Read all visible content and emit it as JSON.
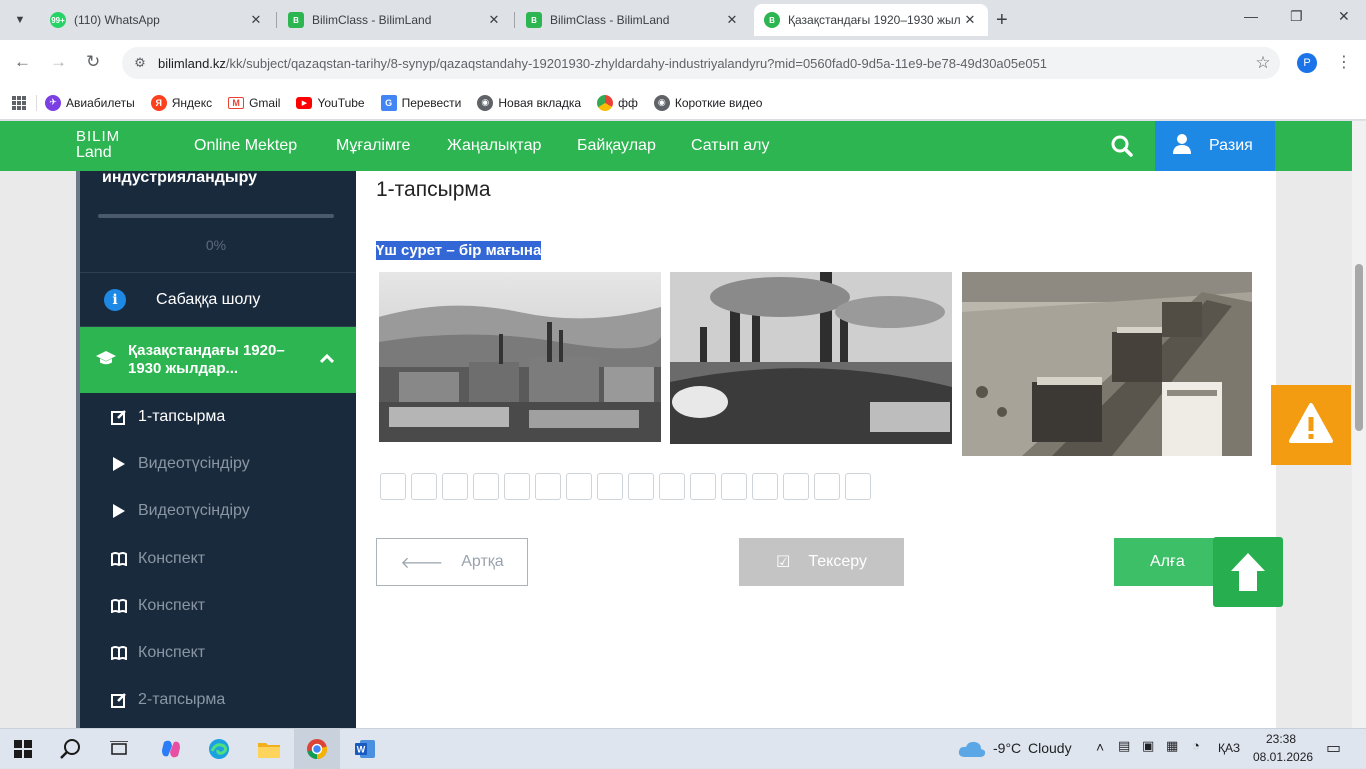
{
  "browser": {
    "tabs": [
      {
        "title": "(110) WhatsApp",
        "badge": "99+",
        "icon": "whatsapp-icon",
        "color": "#25d366"
      },
      {
        "title": "BilimClass - BilimLand",
        "icon": "bilimclass-icon",
        "color": "#2cb551"
      },
      {
        "title": "BilimClass - BilimLand",
        "icon": "bilimclass-icon",
        "color": "#2cb551"
      },
      {
        "title": "Қазақстандағы 1920–1930 жыл",
        "icon": "bilimland-icon",
        "color": "#2cb551"
      }
    ],
    "url_host": "bilimland.kz",
    "url_path": "/kk/subject/qazaqstan-tarihy/8-synyp/qazaqstandahy-19201930-zhyldardahy-industriyalandyru?mid=0560fad0-9d5a-11e9-be78-49d30a05e051",
    "profile_initial": "P",
    "bookmarks": [
      {
        "label": "Авиабилеты",
        "icon": "aviasales-icon",
        "color": "#7b3fe4"
      },
      {
        "label": "Яндекс",
        "icon": "yandex-icon",
        "color": "#fc3f1d"
      },
      {
        "label": "Gmail",
        "icon": "gmail-icon",
        "color": "#ea4335"
      },
      {
        "label": "YouTube",
        "icon": "youtube-icon",
        "color": "#ff0000"
      },
      {
        "label": "Перевести",
        "icon": "translate-icon",
        "color": "#4285f4"
      },
      {
        "label": "Новая вкладка",
        "icon": "chrome-icon",
        "color": "#5f6368"
      },
      {
        "label": "фф",
        "icon": "ff-icon",
        "color": "#fbbc04"
      },
      {
        "label": "Короткие видео",
        "icon": "shorts-icon",
        "color": "#5f6368"
      }
    ]
  },
  "site": {
    "logo_top": "BILIM",
    "logo_bottom": "Land",
    "nav": [
      "Online Mektep",
      "Мұғалімге",
      "Жаңалықтар",
      "Байқаулар",
      "Сатып алу"
    ],
    "user_name": "Разия",
    "brand_color": "#2cb551"
  },
  "sidebar": {
    "lesson_title": "индустрияландыру",
    "progress_percent": 0,
    "progress_label": "0%",
    "overview_label": "Сабаққа шолу",
    "section_label": "Қазақстандағы 1920–1930 жылдар...",
    "items": [
      {
        "label": "1-тапсырма",
        "icon": "edit-icon",
        "current": true
      },
      {
        "label": "Видеотүсіндіру",
        "icon": "play-icon",
        "current": false
      },
      {
        "label": "Видеотүсіндіру",
        "icon": "play-icon",
        "current": false
      },
      {
        "label": "Конспект",
        "icon": "book-icon",
        "current": false
      },
      {
        "label": "Конспект",
        "icon": "book-icon",
        "current": false
      },
      {
        "label": "Конспект",
        "icon": "book-icon",
        "current": false
      },
      {
        "label": "2-тапсырма",
        "icon": "edit-icon",
        "current": false
      }
    ]
  },
  "task": {
    "title": "1-тапсырма",
    "prompt": "Үш сурет – бір мағына",
    "letter_box_count": 16,
    "back_label": "Артқа",
    "check_label": "Тексеру",
    "next_label": "Алға"
  },
  "taskbar": {
    "weather_temp": "-9°C",
    "weather_desc": "Cloudy",
    "language": "ҚАЗ",
    "time": "23:38",
    "date": "08.01.2026"
  }
}
